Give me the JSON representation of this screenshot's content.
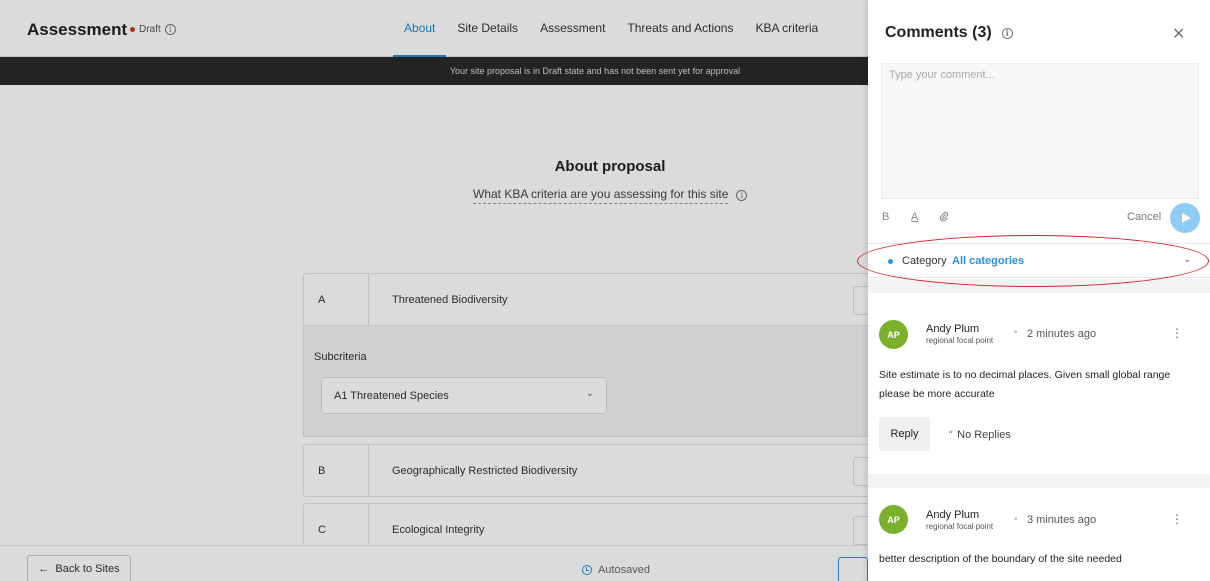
{
  "header": {
    "title": "Assessment",
    "status": "Draft",
    "tabs": [
      {
        "label": "About"
      },
      {
        "label": "Site Details"
      },
      {
        "label": "Assessment"
      },
      {
        "label": "Threats and Actions"
      },
      {
        "label": "KBA criteria"
      }
    ],
    "active_tab": "About"
  },
  "banner": {
    "text": "Your site proposal is in Draft state and has not been sent yet for approval"
  },
  "about": {
    "title": "About proposal",
    "question": "What KBA criteria are you assessing for this site"
  },
  "criteria": [
    {
      "letter": "A",
      "name": "Threatened Biodiversity"
    },
    {
      "letter": "B",
      "name": "Geographically Restricted Biodiversity"
    },
    {
      "letter": "C",
      "name": "Ecological Integrity"
    }
  ],
  "subcriteria": {
    "label": "Subcriteria",
    "selected": "A1 Threatened Species"
  },
  "footer": {
    "back_label": "Back to Sites",
    "autosave_label": "Autosaved"
  },
  "comments_panel": {
    "title": "Comments (3)",
    "placeholder": "Type your comment...",
    "toolbar": {
      "bold": "B",
      "underline": "A",
      "cancel": "Cancel"
    },
    "category": {
      "label": "Category",
      "value": "All categories"
    },
    "comments": [
      {
        "initials": "AP",
        "author": "Andy Plum",
        "role": "regional focal point",
        "time": "2 minutes ago",
        "text": "Site estimate is to no decimal places. Given small global range please be more accurate",
        "reply_label": "Reply",
        "replies_label": "No Replies"
      },
      {
        "initials": "AP",
        "author": "Andy Plum",
        "role": "regional focal point",
        "time": "3 minutes ago",
        "text": "better description of the boundary of the site needed"
      }
    ]
  },
  "colors": {
    "accent": "#1a8ad8",
    "draft_dot": "#c0392b",
    "avatar": "#7ab02c",
    "banner": "#2a2a2a",
    "send_button": "#8ecbf5",
    "highlight_ring": "#d8202a"
  },
  "icons": [
    "info-icon",
    "close-icon",
    "attach-icon",
    "send-icon",
    "chevron-down-icon",
    "clock-icon",
    "kebab-icon",
    "quote-icon",
    "back-arrow-icon"
  ]
}
